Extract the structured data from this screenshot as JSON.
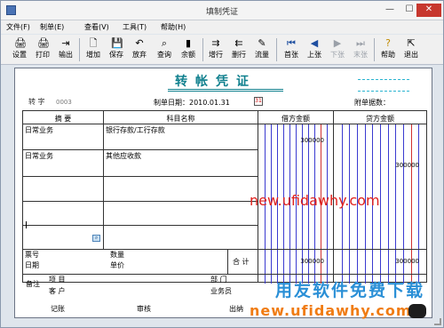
{
  "window": {
    "title": "填制凭证",
    "minimize": "—",
    "maximize": "☐",
    "close": "✕"
  },
  "menu": [
    "文件(F)",
    "制单(E)",
    "查看(V)",
    "工具(T)",
    "帮助(H)"
  ],
  "toolbar": [
    {
      "label": "设置",
      "icon": "printer-setup-icon",
      "glyph": "🖨"
    },
    {
      "label": "打印",
      "icon": "print-icon",
      "glyph": "🖨"
    },
    {
      "label": "输出",
      "icon": "export-icon",
      "glyph": "⇥"
    },
    {
      "label": "增加",
      "icon": "add-icon",
      "glyph": "🗋"
    },
    {
      "label": "保存",
      "icon": "save-icon",
      "glyph": "💾"
    },
    {
      "label": "放弃",
      "icon": "undo-icon",
      "glyph": "↶"
    },
    {
      "label": "查询",
      "icon": "binoculars-icon",
      "glyph": "⌕"
    },
    {
      "label": "余额",
      "icon": "balance-chart-icon",
      "glyph": "▮"
    },
    {
      "label": "增行",
      "icon": "insert-row-icon",
      "glyph": "⇉"
    },
    {
      "label": "删行",
      "icon": "delete-row-icon",
      "glyph": "⇇"
    },
    {
      "label": "流量",
      "icon": "cashflow-icon",
      "glyph": "✎"
    },
    {
      "label": "首张",
      "icon": "first-icon",
      "glyph": "⏮"
    },
    {
      "label": "上张",
      "icon": "previous-icon",
      "glyph": "◀"
    },
    {
      "label": "下张",
      "icon": "next-icon",
      "glyph": "▶"
    },
    {
      "label": "末张",
      "icon": "last-icon",
      "glyph": "⏭"
    },
    {
      "label": "帮助",
      "icon": "help-icon",
      "glyph": "?"
    },
    {
      "label": "退出",
      "icon": "exit-icon",
      "glyph": "⇱"
    }
  ],
  "voucher": {
    "title": "转帐凭证",
    "kind_label": "转 字",
    "number": "0003",
    "date_text": "制单日期：2010.01.31",
    "calendar_glyph": "31",
    "attachments_label": "附单据数：",
    "headers": {
      "summary": "摘 要",
      "account": "科目名称",
      "debit": "借方金额",
      "credit": "贷方金额"
    },
    "rows": [
      {
        "summary": "日常业务",
        "account": "银行存款/工行存款",
        "debit": "300000",
        "credit": ""
      },
      {
        "summary": "日常业务",
        "account": "其他应收款",
        "debit": "",
        "credit": "300000"
      },
      {
        "summary": "",
        "account": "",
        "debit": "",
        "credit": ""
      },
      {
        "summary": "",
        "account": "",
        "debit": "",
        "credit": ""
      },
      {
        "summary": "",
        "account": "",
        "debit": "",
        "credit": ""
      }
    ],
    "footer": {
      "ticket_no": "票号",
      "date": "日期",
      "quantity": "数量",
      "unit_price": "单价",
      "total_label": "合 计",
      "total_debit": "300000",
      "total_credit": "300000",
      "remarks": "备注",
      "project": "项 目",
      "customer": "客 户",
      "department": "部 门",
      "salesperson": "业务员"
    },
    "signatures": {
      "posted": "记账",
      "reviewed": "审核",
      "cashier": "出纳"
    }
  },
  "watermarks": {
    "red": "new.ufidawhy.com",
    "blue": "用友软件免费下载",
    "orange": "new.ufidawhy.com"
  },
  "colors": {
    "title": "#10808e",
    "debit_lines": "#3a3ad0",
    "credit_lines": "#d03030",
    "watermark_red": "#e0211d",
    "watermark_blue": "#2a8fd6",
    "watermark_orange": "#f07c13"
  }
}
